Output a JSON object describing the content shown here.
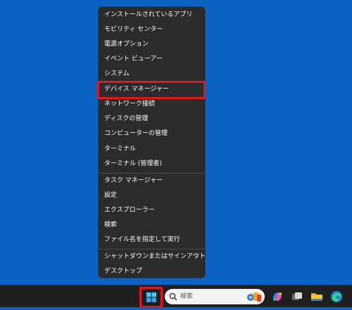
{
  "context_menu": {
    "items": [
      {
        "label": "インストールされているアプリ"
      },
      {
        "label": "モビリティ センター"
      },
      {
        "label": "電源オプション"
      },
      {
        "label": "イベント ビューアー"
      },
      {
        "label": "システム"
      },
      {
        "label": "デバイス マネージャー"
      },
      {
        "label": "ネットワーク接続"
      },
      {
        "label": "ディスクの管理"
      },
      {
        "label": "コンピューターの管理"
      },
      {
        "label": "ターミナル"
      },
      {
        "label": "ターミナル (管理者)"
      },
      {
        "label": "タスク マネージャー"
      },
      {
        "label": "設定"
      },
      {
        "label": "エクスプローラー"
      },
      {
        "label": "検索"
      },
      {
        "label": "ファイル名を指定して実行"
      },
      {
        "label": "シャットダウンまたはサインアウト",
        "submenu_glyph": "›"
      },
      {
        "label": "デスクトップ"
      }
    ]
  },
  "taskbar": {
    "search_placeholder": "検索",
    "icons": [
      "windows-start-icon",
      "search-icon",
      "copilot-icon",
      "task-view-icon",
      "file-explorer-icon",
      "edge-icon"
    ]
  },
  "colors": {
    "desktop_bg": "#0a63c2",
    "menu_bg": "#2b2b2b",
    "highlight": "#e3151c",
    "taskbar_bg": "#1f1f1f"
  }
}
